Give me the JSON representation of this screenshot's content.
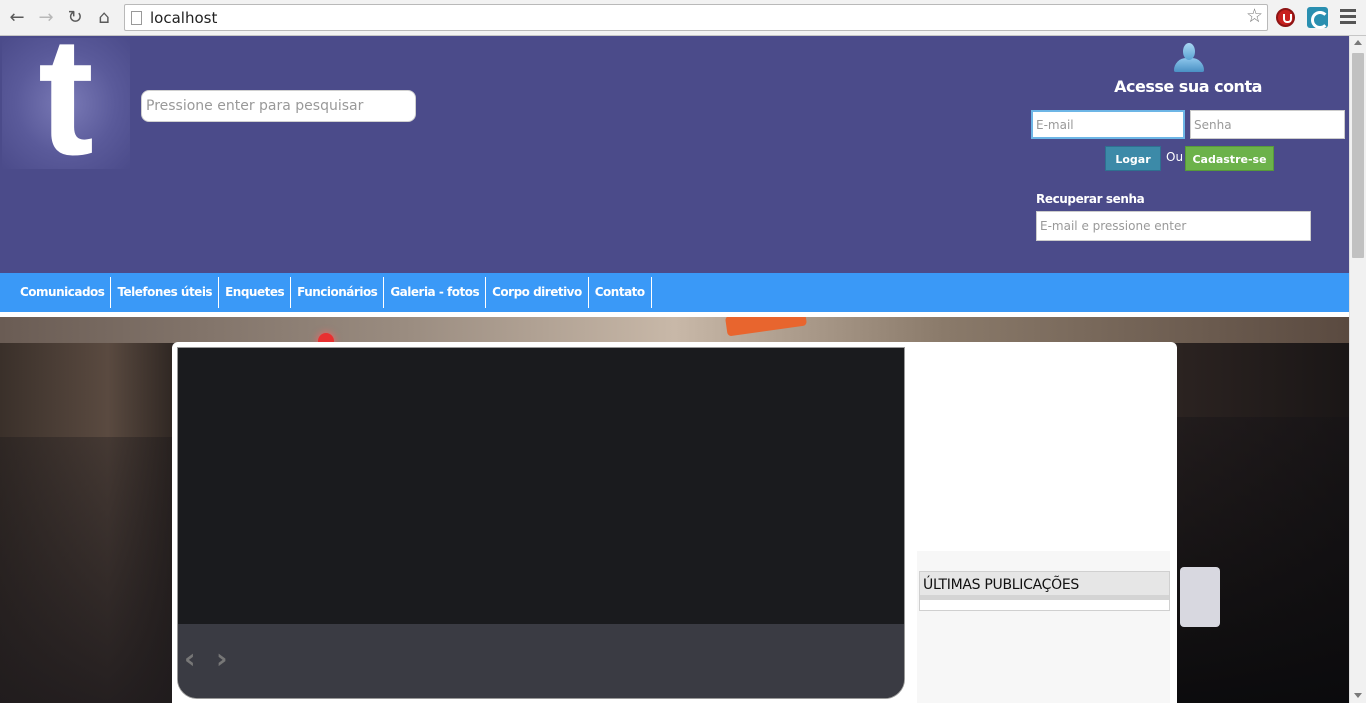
{
  "browser": {
    "url": "localhost",
    "icons": [
      "back-icon",
      "forward-icon",
      "reload-icon",
      "home-icon",
      "page-icon",
      "bookmark-star-icon",
      "extension-icon",
      "extension-icon",
      "menu-icon"
    ]
  },
  "header": {
    "logo_letter": "t",
    "search": {
      "placeholder": "Pressione enter para pesquisar",
      "value": ""
    }
  },
  "login": {
    "title": "Acesse sua conta",
    "email_placeholder": "E-mail",
    "password_placeholder": "Senha",
    "login_button": "Logar",
    "or_text": "Ou",
    "signup_button": "Cadastre-se",
    "recover_label": "Recuperar senha",
    "recover_placeholder": "E-mail e pressione enter"
  },
  "nav": {
    "items": [
      {
        "label": "Comunicados"
      },
      {
        "label": "Telefones úteis"
      },
      {
        "label": "Enquetes"
      },
      {
        "label": "Funcionários"
      },
      {
        "label": "Galeria - fotos"
      },
      {
        "label": "Corpo diretivo"
      },
      {
        "label": "Contato"
      }
    ]
  },
  "slider": {
    "prev_glyph": "‹",
    "next_glyph": "›"
  },
  "sidebar": {
    "latest_title": "ÚLTIMAS PUBLICAÇÕES"
  },
  "colors": {
    "header_bg": "#4b4b8a",
    "nav_bg": "#3a99f7",
    "login_button": "#3c8aa8",
    "signup_button": "#6cb24a"
  }
}
